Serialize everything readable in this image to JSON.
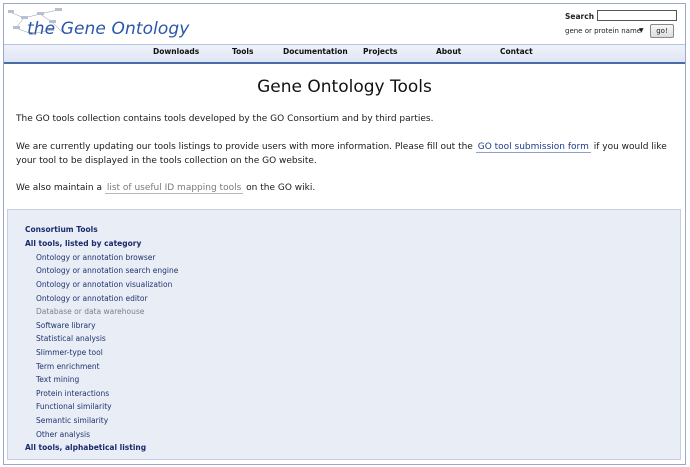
{
  "header": {
    "logo_text": "the Gene Ontology",
    "search_label": "Search",
    "search_value": "",
    "search_type": "gene or protein name",
    "go_button": "go!"
  },
  "nav": {
    "items": [
      {
        "label": "Downloads"
      },
      {
        "label": "Tools"
      },
      {
        "label": "Documentation"
      },
      {
        "label": "Projects"
      },
      {
        "label": "About"
      },
      {
        "label": "Contact"
      }
    ]
  },
  "main": {
    "title": "Gene Ontology Tools",
    "para1": "The GO tools collection contains tools developed by the GO Consortium and by third parties.",
    "para2_before": "We are currently updating our tools listings to provide users with more information. Please fill out the",
    "para2_link": "GO tool submission form",
    "para2_after": "if you would like your tool to be displayed in the tools collection on the GO website.",
    "para3_before": "We also maintain a",
    "para3_link": "list of useful ID mapping tools",
    "para3_after": "on the GO wiki."
  },
  "toolbox": {
    "consortium": "Consortium Tools",
    "by_category": "All tools, listed by category",
    "categories": [
      {
        "label": "Ontology or annotation browser"
      },
      {
        "label": "Ontology or annotation search engine"
      },
      {
        "label": "Ontology or annotation visualization"
      },
      {
        "label": "Ontology or annotation editor"
      },
      {
        "label": "Database or data warehouse"
      },
      {
        "label": "Software library"
      },
      {
        "label": "Statistical analysis"
      },
      {
        "label": "Slimmer-type tool"
      },
      {
        "label": "Term enrichment"
      },
      {
        "label": "Text mining"
      },
      {
        "label": "Protein interactions"
      },
      {
        "label": "Functional similarity"
      },
      {
        "label": "Semantic similarity"
      },
      {
        "label": "Other analysis"
      }
    ],
    "alphabetical": "All tools, alphabetical listing"
  },
  "colors": {
    "link": "#1f3c8c",
    "logo": "#2b57a8",
    "nav_border": "#4b6aa8",
    "toolbox_bg": "#e9edf6"
  }
}
